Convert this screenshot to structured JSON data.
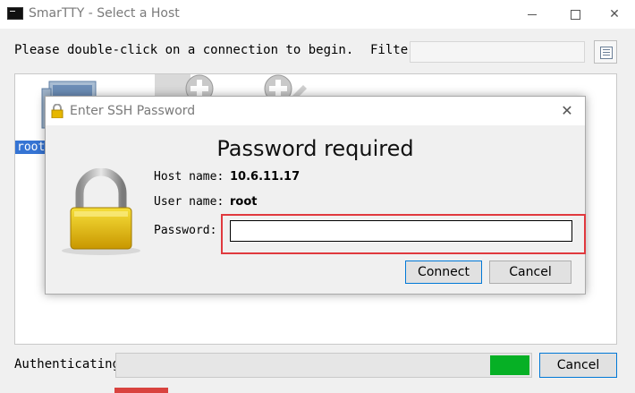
{
  "window": {
    "title": "SmarTTY - Select a Host",
    "minimize_icon": "minimize-icon",
    "maximize_icon": "maximize-icon",
    "close_symbol": "✕"
  },
  "main": {
    "instruction": "Please double-click on a connection to begin.",
    "filter_label": "Filter",
    "filter_value": "",
    "hosts": [
      {
        "label": "root",
        "icon": "computer-icon",
        "selected": true
      }
    ],
    "add_icons": [
      "add-host-icon",
      "add-other-icon"
    ],
    "status_text": "Authenticating",
    "cancel_label": "Cancel"
  },
  "dialog": {
    "title": "Enter SSH Password",
    "close_symbol": "✕",
    "heading": "Password required",
    "host_label": "Host name:",
    "host_value": "10.6.11.17",
    "user_label": "User name:",
    "user_value": "root",
    "password_label": "Password:",
    "password_value": "",
    "connect_label": "Connect",
    "cancel_label": "Cancel"
  },
  "colors": {
    "accent": "#0078d7",
    "progress": "#06b025",
    "highlight": "#e0393e",
    "selection": "#3574d4"
  }
}
